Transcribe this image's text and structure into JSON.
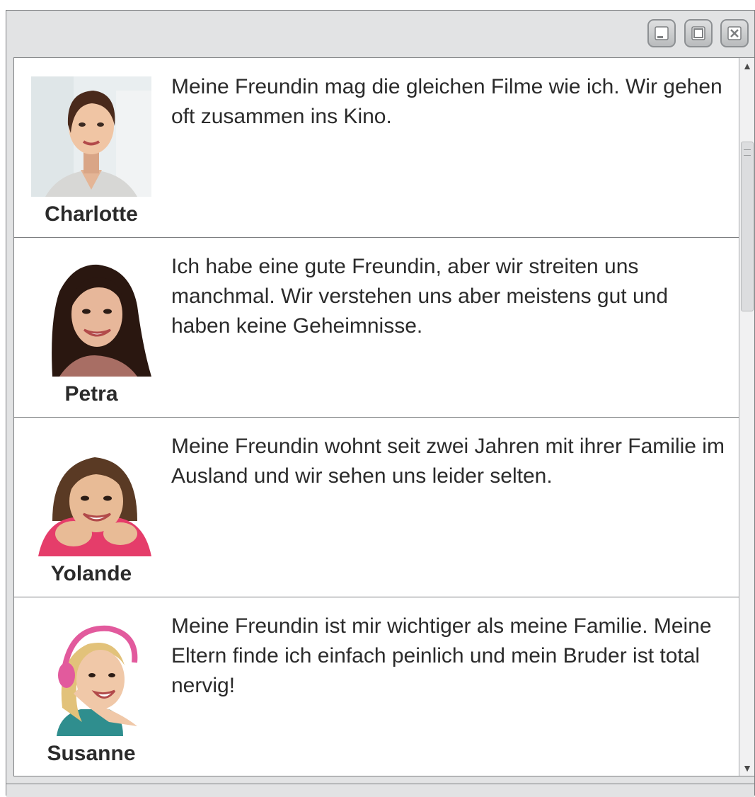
{
  "window": {
    "controls": [
      {
        "name": "minimize-button",
        "icon": "minimize-icon"
      },
      {
        "name": "maximize-button",
        "icon": "maximize-icon"
      },
      {
        "name": "close-button",
        "icon": "close-icon"
      }
    ]
  },
  "entries": [
    {
      "name": "Charlotte",
      "text": "Meine Freundin mag die gleichen Filme wie ich. Wir gehen oft zusammen ins Kino.",
      "photo": "portrait-charlotte"
    },
    {
      "name": "Petra",
      "text": "Ich habe eine gute Freundin, aber wir streiten uns manchmal. Wir verstehen uns aber meistens gut und haben keine Geheimnisse.",
      "photo": "portrait-petra"
    },
    {
      "name": "Yolande",
      "text": "Meine Freundin wohnt seit zwei Jahren mit ihrer Familie im Ausland und wir sehen uns leider selten.",
      "photo": "portrait-yolande"
    },
    {
      "name": "Susanne",
      "text": "Meine Freundin ist mir wichtiger als meine Familie. Meine Eltern finde ich einfach peinlich und mein Bruder ist total nervig!",
      "photo": "portrait-susanne"
    }
  ],
  "scrollbar": {
    "up_icon": "arrow-up-icon",
    "down_icon": "arrow-down-icon",
    "position": 0.15
  },
  "colors": {
    "chrome": "#e2e3e4",
    "border": "#7d7f81",
    "text": "#2b2b2b"
  }
}
